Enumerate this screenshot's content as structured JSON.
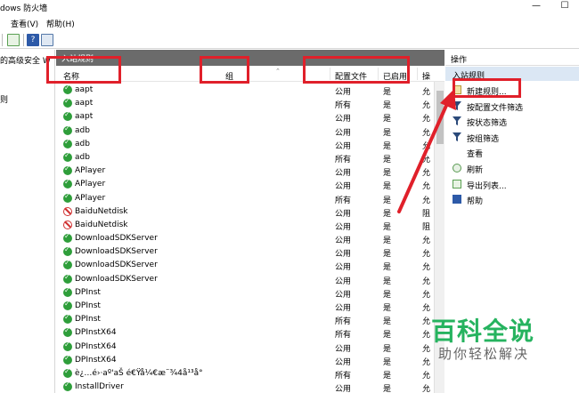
{
  "window": {
    "title": "dows 防火墙",
    "minimize_glyph": "—",
    "maximize_glyph": "☐"
  },
  "menu": {
    "view": "查看(V)",
    "help": "帮助(H)"
  },
  "tree": {
    "item1": "的高级安全 W",
    "item2": "则"
  },
  "center": {
    "pane_title": "入站规则",
    "columns": {
      "name": "名称",
      "group": "组",
      "profile": "配置文件",
      "enabled": "已启用",
      "action": "操"
    },
    "rows": [
      {
        "status": "allow",
        "name": "aapt",
        "profile": "公用",
        "enabled": "是",
        "action": "允"
      },
      {
        "status": "allow",
        "name": "aapt",
        "profile": "所有",
        "enabled": "是",
        "action": "允"
      },
      {
        "status": "allow",
        "name": "aapt",
        "profile": "公用",
        "enabled": "是",
        "action": "允"
      },
      {
        "status": "allow",
        "name": "adb",
        "profile": "公用",
        "enabled": "是",
        "action": "允"
      },
      {
        "status": "allow",
        "name": "adb",
        "profile": "公用",
        "enabled": "是",
        "action": "允"
      },
      {
        "status": "allow",
        "name": "adb",
        "profile": "所有",
        "enabled": "是",
        "action": "允"
      },
      {
        "status": "allow",
        "name": "APlayer",
        "profile": "公用",
        "enabled": "是",
        "action": "允"
      },
      {
        "status": "allow",
        "name": "APlayer",
        "profile": "公用",
        "enabled": "是",
        "action": "允"
      },
      {
        "status": "allow",
        "name": "APlayer",
        "profile": "所有",
        "enabled": "是",
        "action": "允"
      },
      {
        "status": "block",
        "name": "BaiduNetdisk",
        "profile": "公用",
        "enabled": "是",
        "action": "阻"
      },
      {
        "status": "block",
        "name": "BaiduNetdisk",
        "profile": "公用",
        "enabled": "是",
        "action": "阻"
      },
      {
        "status": "allow",
        "name": "DownloadSDKServer",
        "profile": "公用",
        "enabled": "是",
        "action": "允"
      },
      {
        "status": "allow",
        "name": "DownloadSDKServer",
        "profile": "公用",
        "enabled": "是",
        "action": "允"
      },
      {
        "status": "allow",
        "name": "DownloadSDKServer",
        "profile": "公用",
        "enabled": "是",
        "action": "允"
      },
      {
        "status": "allow",
        "name": "DownloadSDKServer",
        "profile": "公用",
        "enabled": "是",
        "action": "允"
      },
      {
        "status": "allow",
        "name": "DPInst",
        "profile": "公用",
        "enabled": "是",
        "action": "允"
      },
      {
        "status": "allow",
        "name": "DPInst",
        "profile": "公用",
        "enabled": "是",
        "action": "允"
      },
      {
        "status": "allow",
        "name": "DPInst",
        "profile": "所有",
        "enabled": "是",
        "action": "允"
      },
      {
        "status": "allow",
        "name": "DPInstX64",
        "profile": "所有",
        "enabled": "是",
        "action": "允"
      },
      {
        "status": "allow",
        "name": "DPInstX64",
        "profile": "公用",
        "enabled": "是",
        "action": "允"
      },
      {
        "status": "allow",
        "name": "DPInstX64",
        "profile": "公用",
        "enabled": "是",
        "action": "允"
      },
      {
        "status": "allow",
        "name": "è¿…é›·aº'aŠ é€Ÿå¼€æ¨¾4å¹³å°",
        "profile": "所有",
        "enabled": "是",
        "action": "允"
      },
      {
        "status": "allow",
        "name": "InstallDriver",
        "profile": "公用",
        "enabled": "是",
        "action": "允"
      }
    ]
  },
  "actions": {
    "title": "操作",
    "section": "入站规则",
    "items": [
      {
        "icon": "new-rule-icon",
        "label": "新建规则..."
      },
      {
        "icon": "filter-icon",
        "label": "按配置文件筛选"
      },
      {
        "icon": "filter-icon",
        "label": "按状态筛选"
      },
      {
        "icon": "filter-icon",
        "label": "按组筛选"
      },
      {
        "icon": "",
        "label": "查看"
      },
      {
        "icon": "refresh-icon",
        "label": "刷新"
      },
      {
        "icon": "export-icon",
        "label": "导出列表..."
      },
      {
        "icon": "help-icon",
        "label": "帮助"
      }
    ]
  },
  "watermark": {
    "main": "百科全说",
    "sub": "助你轻松解决"
  },
  "colors": {
    "annotation_red": "#e0202a",
    "allow_green": "#2e9e3a",
    "block_red": "#d03030",
    "action_section_bg": "#dbe7f4"
  }
}
